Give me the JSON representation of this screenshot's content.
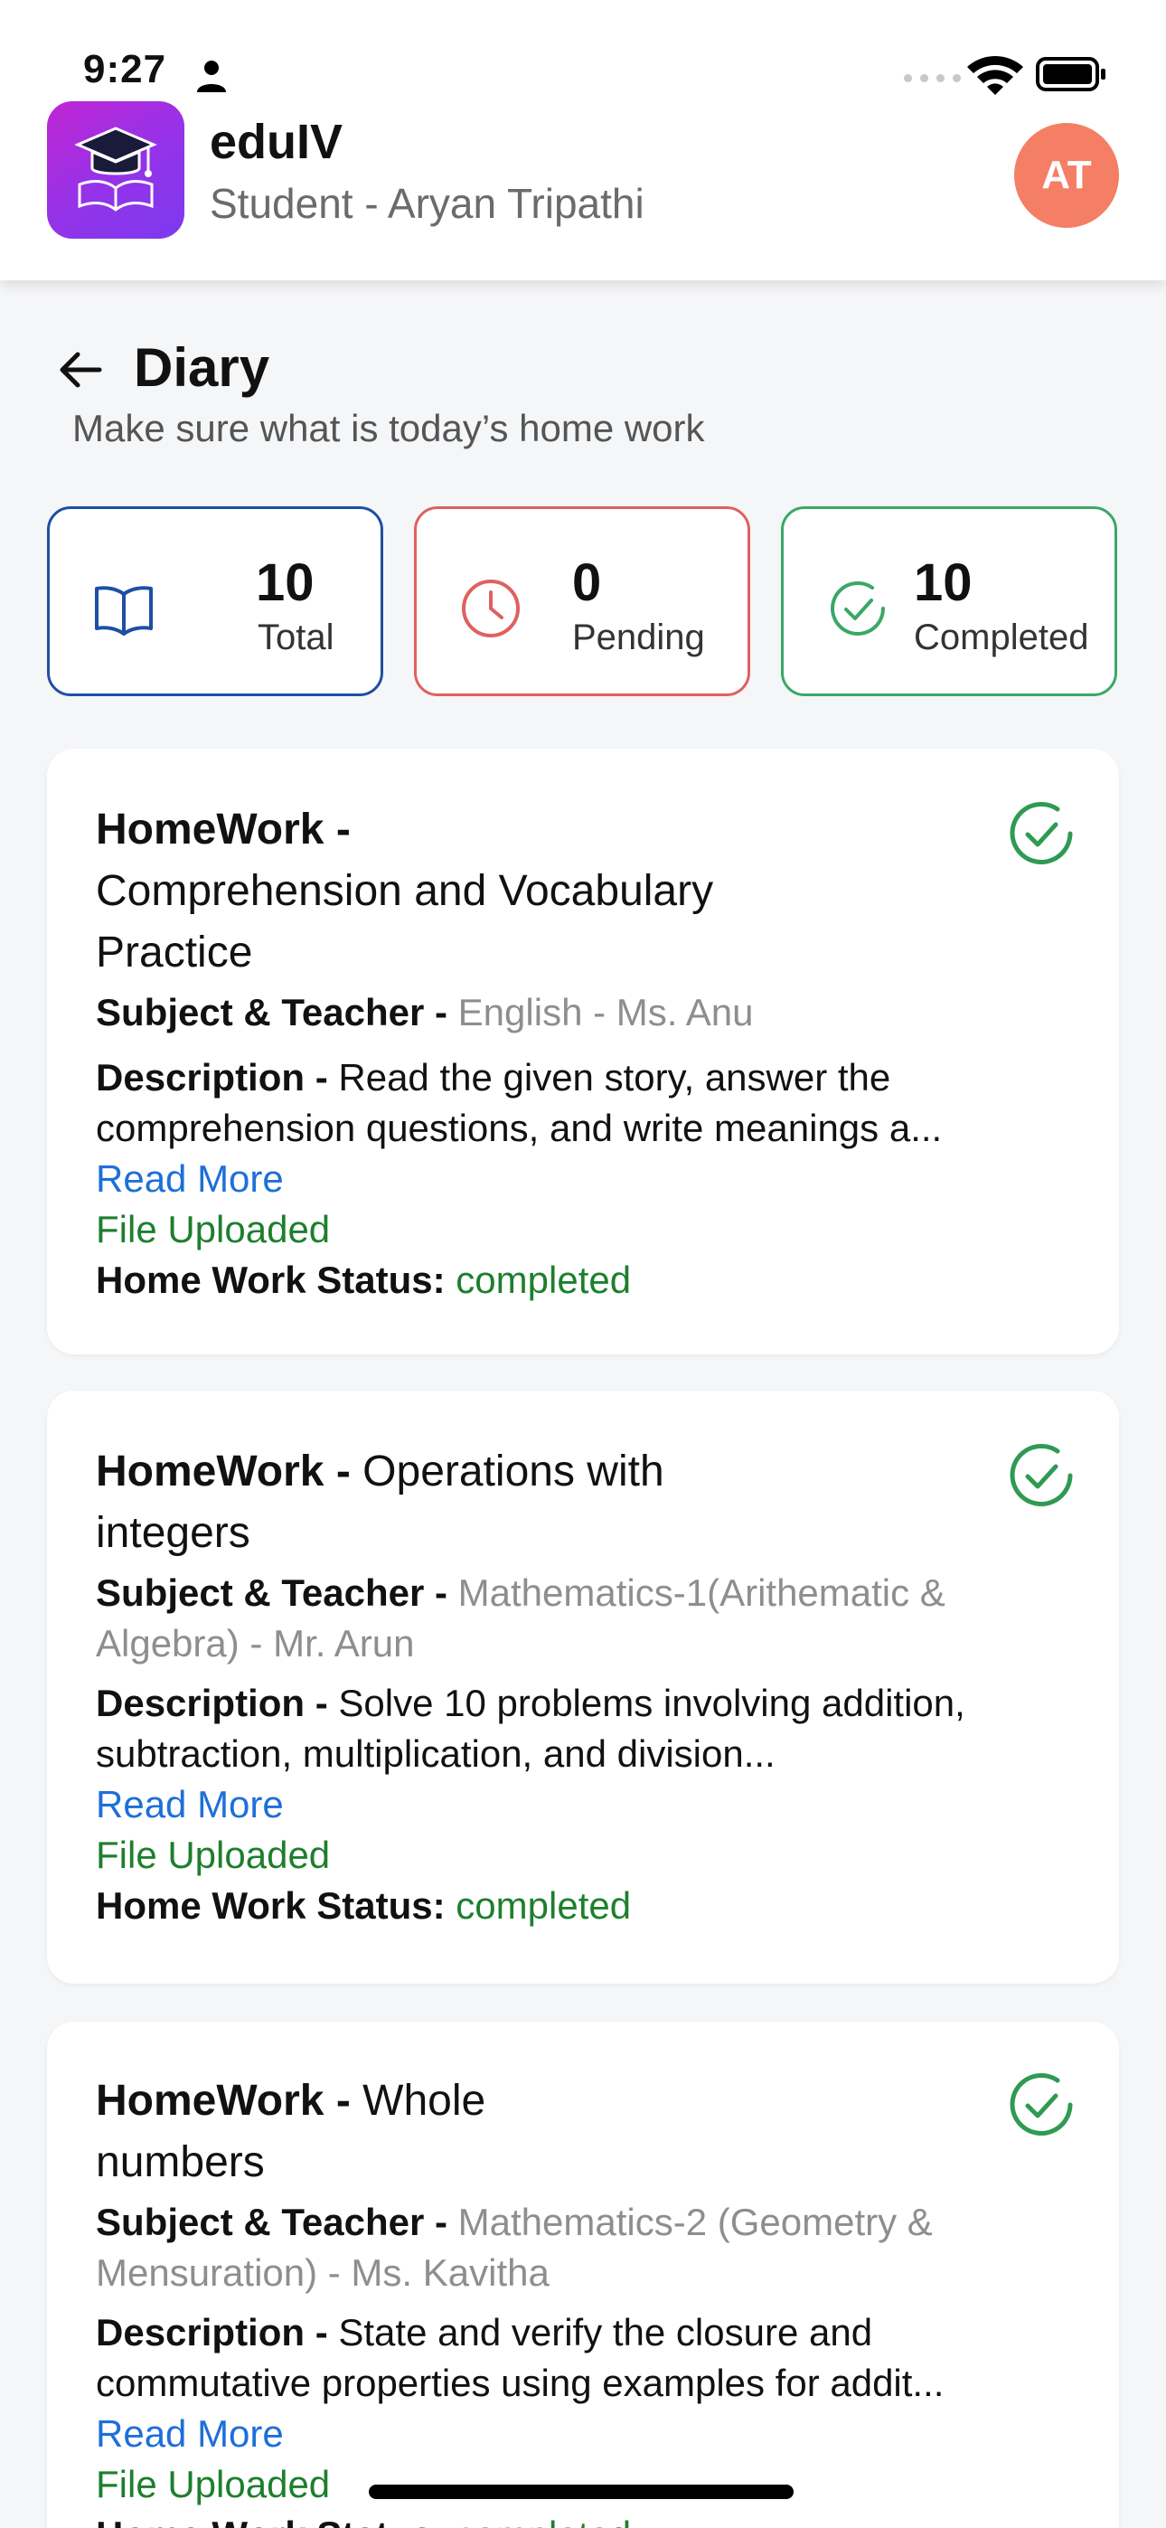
{
  "status_bar": {
    "time": "9:27"
  },
  "header": {
    "app_name": "eduIV",
    "subtitle": "Student - Aryan Tripathi",
    "avatar_initials": "AT",
    "logo_icon": "graduation-cap-book-icon"
  },
  "page": {
    "title": "Diary",
    "subtitle": "Make sure what is today’s home work"
  },
  "stats": [
    {
      "value": "10",
      "label": "Total",
      "icon": "book-icon",
      "color": "#1e4fa3"
    },
    {
      "value": "0",
      "label": "Pending",
      "icon": "clock-icon",
      "color": "#e06060"
    },
    {
      "value": "10",
      "label": "Completed",
      "icon": "check-circle-icon",
      "color": "#3aa866"
    }
  ],
  "homeworks": [
    {
      "prefix": "HomeWork -",
      "title": "Comprehension and Vocabulary Practice",
      "subject_label": "Subject & Teacher -",
      "subject": "English - Ms. Anu",
      "description_label": "Description -",
      "description": "Read the given story, answer the comprehension questions, and write meanings a...",
      "read_more": "Read More",
      "file_status": "File Uploaded",
      "status_label": "Home Work Status:",
      "status": "completed"
    },
    {
      "prefix": "HomeWork -",
      "title": "Operations with integers",
      "subject_label": "Subject & Teacher -",
      "subject": "Mathematics-1(Arithematic & Algebra) - Mr. Arun",
      "description_label": "Description -",
      "description": "Solve 10 problems involving addition, subtraction, multiplication, and division...",
      "read_more": "Read More",
      "file_status": "File Uploaded",
      "status_label": "Home Work Status:",
      "status": "completed"
    },
    {
      "prefix": "HomeWork -",
      "title": "Whole numbers",
      "subject_label": "Subject & Teacher -",
      "subject": "Mathematics-2 (Geometry & Mensuration) - Ms. Kavitha",
      "description_label": "Description -",
      "description": "State and verify the closure and commutative properties using examples for addit...",
      "read_more": "Read More",
      "file_status": "File Uploaded",
      "status_label": "Home Work Status:",
      "status": "completed"
    }
  ],
  "colors": {
    "accent_blue": "#1e6fd9",
    "success_green": "#1d7f2d",
    "avatar_bg": "#f47f65"
  }
}
